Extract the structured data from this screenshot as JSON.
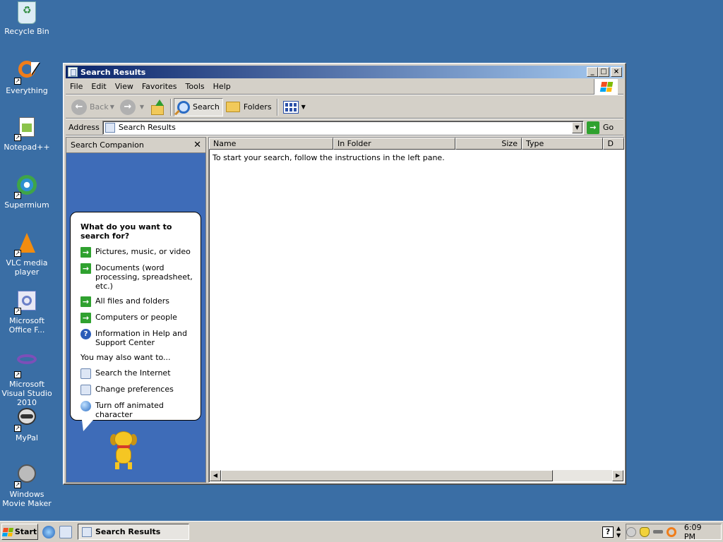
{
  "desktop": {
    "icons": [
      {
        "label": "Recycle Bin",
        "icon": "recycle-bin-icon",
        "color": "#9fd3ef"
      },
      {
        "label": "Everything",
        "icon": "everything-search-icon",
        "color": "#f07d1a"
      },
      {
        "label": "Notepad++",
        "icon": "notepad-plus-plus-icon",
        "color": "#8bc34a"
      },
      {
        "label": "Supermium",
        "icon": "supermium-browser-icon",
        "color": "#2f8fd0"
      },
      {
        "label": "VLC media player",
        "icon": "vlc-cone-icon",
        "color": "#f28c0f"
      },
      {
        "label": "Microsoft Office F...",
        "icon": "office-icon",
        "color": "#6b7fc8"
      },
      {
        "label": "Microsoft Visual Studio 2010",
        "icon": "visual-studio-icon",
        "color": "#7d4fb8"
      },
      {
        "label": "MyPal",
        "icon": "mypal-raccoon-icon",
        "color": "#5a5a5a"
      },
      {
        "label": "Windows Movie Maker",
        "icon": "movie-maker-icon",
        "color": "#3fa548"
      }
    ]
  },
  "window": {
    "title": "Search Results",
    "buttons": {
      "minimize": "_",
      "maximize": "□",
      "close": "×"
    },
    "menu": [
      "File",
      "Edit",
      "View",
      "Favorites",
      "Tools",
      "Help"
    ],
    "toolbar": {
      "back": "Back",
      "search": "Search",
      "folders": "Folders"
    },
    "address": {
      "label": "Address",
      "value": "Search Results",
      "go": "Go"
    },
    "search_companion": {
      "header": "Search Companion",
      "question": "What do you want to search for?",
      "options": [
        "Pictures, music, or video",
        "Documents (word processing, spreadsheet, etc.)",
        "All files and folders",
        "Computers or people",
        "Information in Help and Support Center"
      ],
      "also_label": "You may also want to...",
      "also_options": [
        "Search the Internet",
        "Change preferences",
        "Turn off animated character"
      ]
    },
    "results": {
      "columns": [
        "Name",
        "In Folder",
        "Size",
        "Type",
        "D"
      ],
      "message": "To start your search, follow the instructions in the left pane."
    }
  },
  "taskbar": {
    "start": "Start",
    "task": "Search Results",
    "help": "?",
    "clock": "6:09 PM"
  },
  "colors": {
    "desktop": "#3a6ea5",
    "titlebar_start": "#0a246a",
    "companion_bg": "#3e6cb8",
    "go_green": "#2fa12f"
  }
}
